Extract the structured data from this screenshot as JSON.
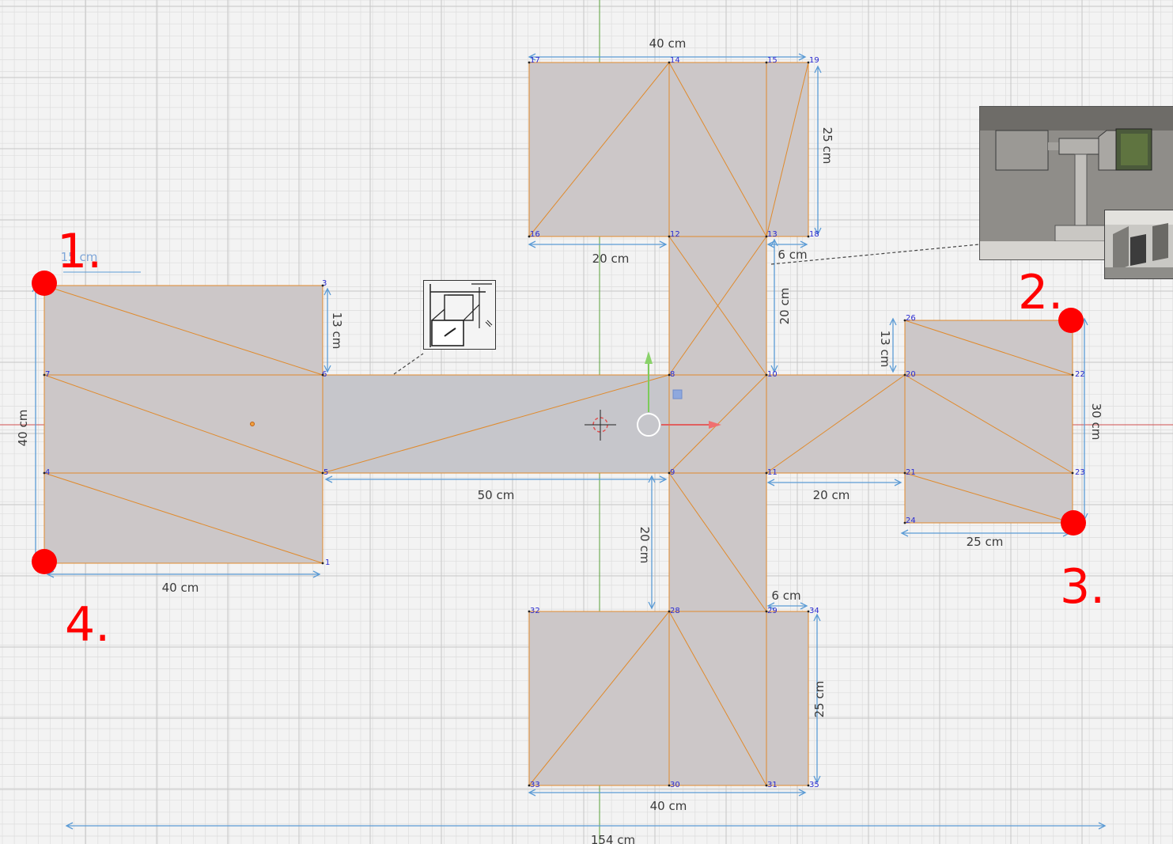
{
  "colors": {
    "background": "#f3f3f3",
    "grid_minor": "#dddddd",
    "grid_major": "#c6c6c6",
    "face": "#ccc7c8",
    "face_selected": "#c6c6cb",
    "edge": "#e08a2c",
    "dimension": "#5b9bd5",
    "vertex_label": "#2b2bd1",
    "marker": "#ff0000",
    "axis_x": "#d25050",
    "axis_y": "#58a03a"
  },
  "dimensions": {
    "d_15": "15 cm",
    "d_40_left": "40 cm",
    "d_13_left": "13 cm",
    "d_40_bottom_left": "40 cm",
    "d_50": "50 cm",
    "d_40_top": "40 cm",
    "d_25_top": "25 cm",
    "d_20_top": "20 cm",
    "d_6_top": "6 cm",
    "d_20_mid_upper": "20 cm",
    "d_13_right": "13 cm",
    "d_30": "30 cm",
    "d_20_right": "20 cm",
    "d_25_right": "25 cm",
    "d_20_mid_lower": "20 cm",
    "d_6_bottom": "6 cm",
    "d_25_bottom": "25 cm",
    "d_40_bottom": "40 cm",
    "d_154": "154 cm"
  },
  "vertices": [
    {
      "id": "1"
    },
    {
      "id": "3"
    },
    {
      "id": "4"
    },
    {
      "id": "5"
    },
    {
      "id": "6"
    },
    {
      "id": "7"
    },
    {
      "id": "8"
    },
    {
      "id": "9"
    },
    {
      "id": "10"
    },
    {
      "id": "11"
    },
    {
      "id": "12"
    },
    {
      "id": "13"
    },
    {
      "id": "14"
    },
    {
      "id": "15"
    },
    {
      "id": "16"
    },
    {
      "id": "17"
    },
    {
      "id": "18"
    },
    {
      "id": "19"
    },
    {
      "id": "20"
    },
    {
      "id": "21"
    },
    {
      "id": "22"
    },
    {
      "id": "23"
    },
    {
      "id": "24"
    },
    {
      "id": "26"
    },
    {
      "id": "28"
    },
    {
      "id": "29"
    },
    {
      "id": "30"
    },
    {
      "id": "31"
    },
    {
      "id": "32"
    },
    {
      "id": "33"
    },
    {
      "id": "34"
    },
    {
      "id": "35"
    }
  ],
  "markers": [
    {
      "label": "1."
    },
    {
      "label": "2."
    },
    {
      "label": "3."
    },
    {
      "label": "4."
    }
  ]
}
